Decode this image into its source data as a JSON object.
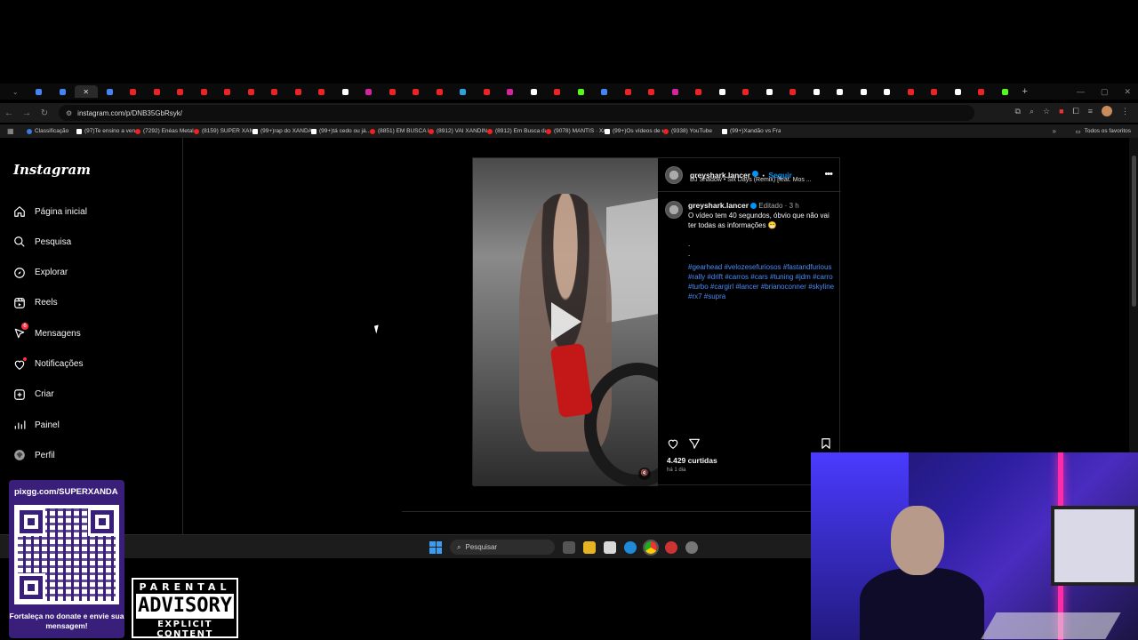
{
  "browser": {
    "url": "instagram.com/p/DNB35GbRsyk/",
    "tabs": [
      {
        "icon": "chevron-down-icon"
      },
      {
        "icon": "chrome-icon"
      },
      {
        "icon": "chrome-icon"
      },
      {
        "icon": "close-icon",
        "active": true
      },
      {
        "icon": "chrome-icon"
      },
      {
        "icon": "youtube-icon"
      },
      {
        "icon": "youtube-icon"
      },
      {
        "icon": "youtube-icon"
      },
      {
        "icon": "youtube-icon"
      },
      {
        "icon": "youtube-icon"
      },
      {
        "icon": "youtube-icon"
      },
      {
        "icon": "youtube-icon"
      },
      {
        "icon": "youtube-icon"
      },
      {
        "icon": "youtube-icon"
      },
      {
        "icon": "tiktok-icon"
      },
      {
        "icon": "instagram-icon"
      },
      {
        "icon": "youtube-icon"
      },
      {
        "icon": "youtube-icon"
      },
      {
        "icon": "youtube-icon"
      },
      {
        "icon": "telegram-icon"
      },
      {
        "icon": "youtube-icon"
      },
      {
        "icon": "instagram-icon"
      },
      {
        "icon": "tiktok-icon"
      },
      {
        "icon": "youtube-icon"
      },
      {
        "icon": "kick-icon"
      },
      {
        "icon": "chrome-icon"
      },
      {
        "icon": "youtube-icon"
      },
      {
        "icon": "youtube-icon"
      },
      {
        "icon": "instagram-icon"
      },
      {
        "icon": "youtube-icon"
      },
      {
        "icon": "tiktok-icon"
      },
      {
        "icon": "youtube-icon"
      },
      {
        "icon": "tiktok-icon"
      },
      {
        "icon": "youtube-icon"
      },
      {
        "icon": "tiktok-icon"
      },
      {
        "icon": "tiktok-icon"
      },
      {
        "icon": "tiktok-icon"
      },
      {
        "icon": "tiktok-icon"
      },
      {
        "icon": "youtube-icon"
      },
      {
        "icon": "youtube-icon"
      },
      {
        "icon": "tiktok-icon"
      },
      {
        "icon": "youtube-icon"
      },
      {
        "icon": "kick-icon"
      }
    ],
    "new_tab": "+",
    "bookmarks": [
      {
        "label": "Classificação",
        "type": "cls"
      },
      {
        "label": "(97)Te ensino a venc...",
        "type": "tt"
      },
      {
        "label": "(7292) Enéas Metal |...",
        "type": "yt"
      },
      {
        "label": "(8159) SUPER XAND...",
        "type": "yt"
      },
      {
        "label": "(99+)rap do XANDÃ...",
        "type": "tt"
      },
      {
        "label": "(99+)tá cedo ou já...",
        "type": "tt"
      },
      {
        "label": "(8851) EM BUSCA D...",
        "type": "yt"
      },
      {
        "label": "(8912) VAI XANDIN...",
        "type": "yt"
      },
      {
        "label": "(8912) Em Busca da...",
        "type": "yt"
      },
      {
        "label": "(9078) MANTIS · XA...",
        "type": "yt"
      },
      {
        "label": "(99+)Os vídeos de c...",
        "type": "tt"
      },
      {
        "label": "(9338) YouTube",
        "type": "yt"
      },
      {
        "label": "(99+)Xandão vs Fra...",
        "type": "tt"
      }
    ],
    "bookmarks_more": "»",
    "favorites_label": "Todos os favoritos"
  },
  "instagram": {
    "logo": "Instagram",
    "nav": [
      {
        "label": "Página inicial",
        "icon": "home-icon"
      },
      {
        "label": "Pesquisa",
        "icon": "search-icon"
      },
      {
        "label": "Explorar",
        "icon": "compass-icon"
      },
      {
        "label": "Reels",
        "icon": "reels-icon"
      },
      {
        "label": "Mensagens",
        "icon": "messenger-icon",
        "badge": "6"
      },
      {
        "label": "Notificações",
        "icon": "heart-icon"
      },
      {
        "label": "Criar",
        "icon": "plus-square-icon"
      },
      {
        "label": "Painel",
        "icon": "dashboard-icon"
      },
      {
        "label": "Perfil",
        "icon": "avatar-icon"
      }
    ],
    "post": {
      "username": "greyshark.lancer",
      "follow": "Seguir",
      "separator": "•",
      "audio": "DJ Shadow • Six Days (Remix) [feat. Mos ...",
      "caption_user": "greyshark.lancer",
      "edited": "Editado",
      "edited_time": "3 h",
      "caption_text": "O vídeo tem 40 segundos, óbvio que não vai ter todas as informações 😁",
      "dots": ".\n.",
      "hashtags": "#gearhead #velozesefuriosos #fastandfurious #rally #drift #carros #cars #tuning #jdm #carro #turbo #cargirl #lancer #brianoconner #skyline #rx7 #supra",
      "likes": "4.429 curtidas",
      "posted": "há 1 dia"
    }
  },
  "taskbar": {
    "search_placeholder": "Pesquisar"
  },
  "overlay": {
    "qr_url": "pixgg.com/SUPERXANDA",
    "qr_message": "Fortaleça no donate e envie sua mensagem!",
    "advisory_top": "PARENTAL",
    "advisory_mid": "ADVISORY",
    "advisory_bottom": "EXPLICIT CONTENT"
  },
  "colors": {
    "accent": "#0095f6",
    "hashtag": "#4a8cf7",
    "badge": "#ff3040",
    "qr_bg": "#3a1f7a"
  }
}
